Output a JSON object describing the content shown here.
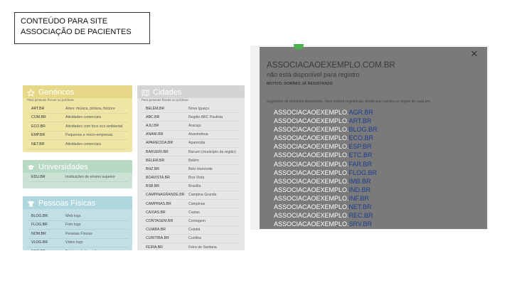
{
  "title": {
    "line1": "CONTEÚDO PARA SITE",
    "line2": "ASSOCIAÇÃO DE PACIENTES"
  },
  "panels": {
    "genericos": {
      "title": "Genéricos",
      "subtitle": "Para pessoas físicas ou jurídicas",
      "rows": [
        {
          "domain": "ART.BR",
          "desc": "Artes: música, pintura, folclore"
        },
        {
          "domain": "COM.BR",
          "desc": "Atividades comerciais"
        },
        {
          "domain": "ECO.BR",
          "desc": "Atividades com foco eco-ambiental"
        },
        {
          "domain": "EMP.BR",
          "desc": "Pequenas e micro-empresas"
        },
        {
          "domain": "NET.BR",
          "desc": "Atividades comerciais"
        }
      ]
    },
    "universidades": {
      "title": "Universidades",
      "rows": [
        {
          "domain": "EDU.BR",
          "desc": "Instituições de ensino superior"
        }
      ]
    },
    "pessoas_fisicas": {
      "title": "Pessoas Físicas",
      "rows": [
        {
          "domain": "BLOG.BR",
          "desc": "Web logs"
        },
        {
          "domain": "FLOG.BR",
          "desc": "Foto logs"
        },
        {
          "domain": "NOM.BR",
          "desc": "Pessoas Físicas"
        },
        {
          "domain": "VLOG.BR",
          "desc": "Vídeo logs"
        },
        {
          "domain": "WIKI.BR",
          "desc": "Páginas do tipo wiki"
        }
      ]
    },
    "cidades": {
      "title": "Cidades",
      "subtitle": "Para pessoas físicas ou jurídicas",
      "rows": [
        {
          "domain": "BELÉM.BR",
          "desc": "Nova Iguaçu"
        },
        {
          "domain": "ABC.BR",
          "desc": "Região ABC Paulista"
        },
        {
          "domain": "AJU.BR",
          "desc": "Aracaju"
        },
        {
          "domain": "ANANI.BR",
          "desc": "Ananindeua"
        },
        {
          "domain": "APARECIDA.BR",
          "desc": "Aparecida"
        },
        {
          "domain": "BARUERI.BR",
          "desc": "Barueri (município da região)"
        },
        {
          "domain": "BELEM.BR",
          "desc": "Belém"
        },
        {
          "domain": "BHZ.BR",
          "desc": "Belo Horizonte"
        },
        {
          "domain": "BOAVISTA.BR",
          "desc": "Boa Vista"
        },
        {
          "domain": "BSB.BR",
          "desc": "Brasília"
        },
        {
          "domain": "CAMPINAGRANDE.BR",
          "desc": "Campina Grande"
        },
        {
          "domain": "CAMPINAS.BR",
          "desc": "Campinas"
        },
        {
          "domain": "CAXIAS.BR",
          "desc": "Caxias"
        },
        {
          "domain": "CONTAGEM.BR",
          "desc": "Contagem"
        },
        {
          "domain": "CUIABA.BR",
          "desc": "Cuiabá"
        },
        {
          "domain": "CURITIBA.BR",
          "desc": "Curitiba"
        },
        {
          "domain": "FEIRA.BR",
          "desc": "Feira de Santana"
        }
      ]
    }
  },
  "modal": {
    "domain": "ASSOCIACAOEXEMPLO.COM.BR",
    "status": "não está disponível para registro",
    "motivo": "MOTIVO: DOMÍNIO JÁ REGISTRADO",
    "suggestion_intro": "Sugestões de domínios disponíveis. Você poderá registrá-las, desde que cumpra as regras de cada um.",
    "close_symbol": "✕",
    "base": "ASSOCIACAOEXEMPLO.",
    "suggestions": [
      "AGR.BR",
      "ART.BR",
      "BLOG.BR",
      "ECO.BR",
      "ESP.BR",
      "ETC.BR",
      "FAR.BR",
      "FLOG.BR",
      "IMB.BR",
      "IND.BR",
      "INF.BR",
      "NET.BR",
      "REC.BR",
      "SRV.BR"
    ]
  },
  "icons": {
    "genericos": "star-icon",
    "universidades": "graduation-cap-icon",
    "pessoas_fisicas": "shirt-icon",
    "cidades": "map-icon",
    "close": "close-icon"
  },
  "colors": {
    "genericos": "#efe6a6",
    "universidades": "#c9e2d3",
    "pessoas_fisicas": "#c1dfe5",
    "cidades": "#e6e6e6",
    "modal_bg": "#7a7a7a",
    "link": "#ffffff",
    "link_ext": "#1a3d8f",
    "notch": "#4caf50"
  }
}
